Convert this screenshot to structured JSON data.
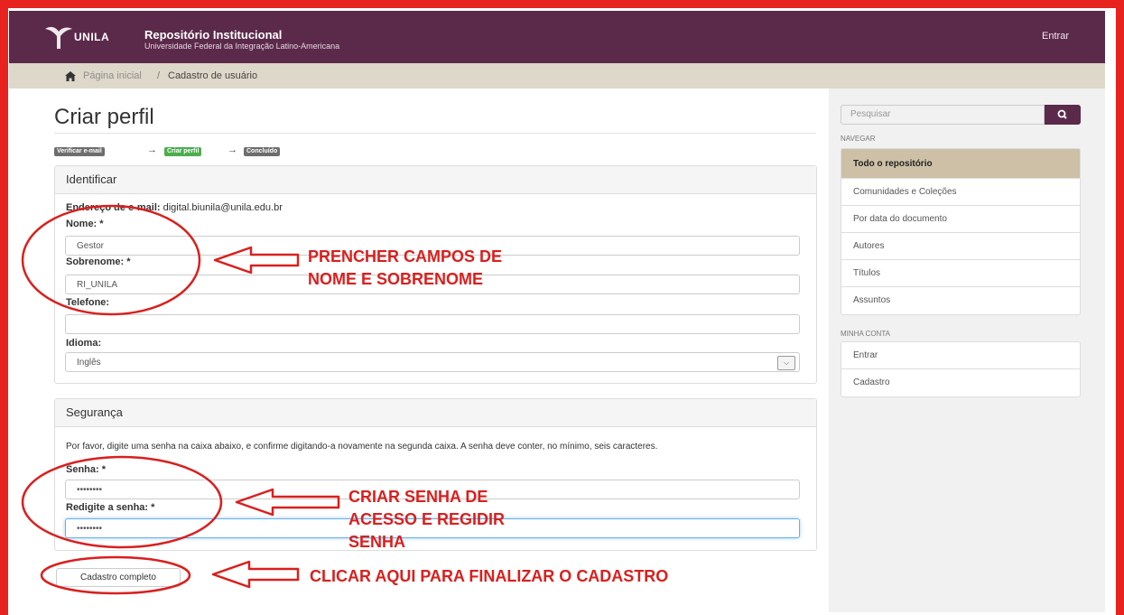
{
  "header": {
    "logo_text": "UNILA",
    "title": "Repositório Institucional",
    "subtitle": "Universidade Federal da Integração Latino-Americana",
    "login": "Entrar"
  },
  "breadcrumb": {
    "home": "Página inicial",
    "separator": "/",
    "current": "Cadastro de usuário"
  },
  "page": {
    "title": "Criar perfil"
  },
  "steps": [
    {
      "label": "Verificar e-mail",
      "state": "done"
    },
    {
      "label": "Criar perfil",
      "state": "active"
    },
    {
      "label": "Concluído",
      "state": "pending"
    }
  ],
  "identify": {
    "heading": "Identificar",
    "email_label": "Endereço de e-mail:",
    "email_value": "digital.biunila@unila.edu.br",
    "name_label": "Nome: *",
    "name_value": "Gestor",
    "surname_label": "Sobrenome: *",
    "surname_value": "RI_UNILA",
    "phone_label": "Telefone:",
    "phone_value": "",
    "language_label": "Idioma:",
    "language_value": "Inglês"
  },
  "security": {
    "heading": "Segurança",
    "info": "Por favor, digite uma senha na caixa abaixo, e confirme digitando-a novamente na segunda caixa. A senha deve conter, no mínimo, seis caracteres.",
    "password_label": "Senha: *",
    "password_value": "••••••••",
    "confirm_label": "Redigite a senha: *",
    "confirm_value": "••••••••"
  },
  "submit_label": "Cadastro completo",
  "sidebar": {
    "search_placeholder": "Pesquisar",
    "nav_heading": "NAVEGAR",
    "nav_items": [
      {
        "label": "Todo o repositório",
        "active": true
      },
      {
        "label": "Comunidades e Coleções"
      },
      {
        "label": "Por data do documento"
      },
      {
        "label": "Autores"
      },
      {
        "label": "Títulos"
      },
      {
        "label": "Assuntos"
      }
    ],
    "account_heading": "MINHA CONTA",
    "account_items": [
      {
        "label": "Entrar"
      },
      {
        "label": "Cadastro"
      }
    ]
  },
  "annotations": {
    "name_note_1": "PRENCHER CAMPOS DE",
    "name_note_2": "NOME E SOBRENOME",
    "password_note_1": "CRIAR SENHA DE",
    "password_note_2": "ACESSO E REGIDIR",
    "password_note_3": "SENHA",
    "submit_note": "CLICAR AQUI PARA FINALIZAR O CADASTRO",
    "color": "#d9201e"
  },
  "colors": {
    "header_bg": "#5b2a4a",
    "breadcrumb_bg": "#ddd8c9",
    "sidebar_active": "#cdc0a6",
    "frame": "#e8231f"
  }
}
